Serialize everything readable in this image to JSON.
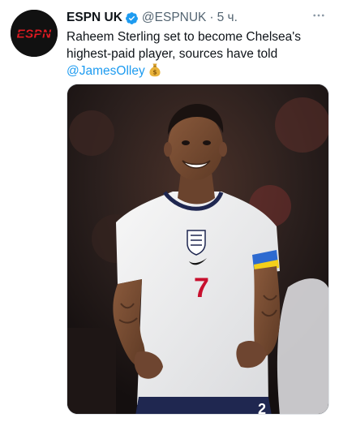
{
  "tweet": {
    "author_name": "ESPN UK",
    "author_handle": "@ESPNUK",
    "separator": "·",
    "time": "5 ч.",
    "text_line1": "Raheem Sterling set to become Chelsea's",
    "text_line2": "highest-paid player, sources have told",
    "mention": "@JamesOlley",
    "emoji": "money-bag"
  },
  "avatar": {
    "logo_text": "ESPN",
    "logo_color": "#e01a22",
    "background": "#111111"
  },
  "media": {
    "subject": "footballer in white England national team shirt, number 7, smiling",
    "shirt_number": "7",
    "colors": {
      "shirt": "#f2f2f2",
      "number": "#c8102e",
      "collar": "#1f2750",
      "background": "#2a1f1d"
    }
  },
  "icons": {
    "verified": "verified-badge-icon",
    "more": "more-options-icon"
  },
  "colors": {
    "link": "#1d9bf0",
    "secondary_text": "#536471",
    "primary_text": "#0f1419"
  }
}
